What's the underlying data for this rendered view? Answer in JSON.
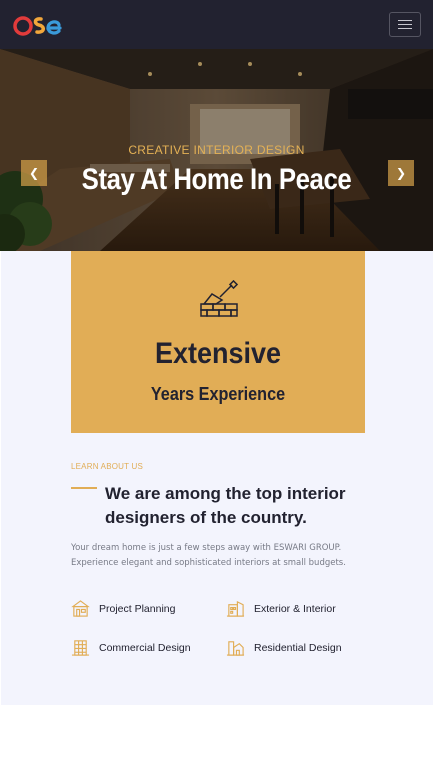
{
  "brand": {
    "logo_text": "ose",
    "logo_colors": [
      "#e23b3b",
      "#f2a73b",
      "#3a9ad9"
    ]
  },
  "navbar": {
    "toggler_icon": "hamburger-icon"
  },
  "hero": {
    "subtitle": "CREATIVE INTERIOR DESIGN",
    "title": "Stay At Home In Peace",
    "prev_icon": "chevron-left-icon",
    "next_icon": "chevron-right-icon"
  },
  "experience": {
    "icon": "brick-trowel-icon",
    "headline": "Extensive",
    "subline": "Years Experience"
  },
  "about": {
    "kicker": "LEARN ABOUT US",
    "heading": "We are among the top interior designers of the country.",
    "description": "Your dream home is just a few steps away with ESWARI GROUP. Experience elegant and sophisticated interiors at small budgets.",
    "features": [
      {
        "label": "Project Planning",
        "icon": "planning-icon"
      },
      {
        "label": "Exterior & Interior",
        "icon": "interior-icon"
      },
      {
        "label": "Commercial Design",
        "icon": "commercial-building-icon"
      },
      {
        "label": "Residential Design",
        "icon": "residential-home-icon"
      }
    ]
  },
  "colors": {
    "accent": "#e1ad56",
    "dark": "#222230",
    "section_bg": "#f3f4fd"
  }
}
